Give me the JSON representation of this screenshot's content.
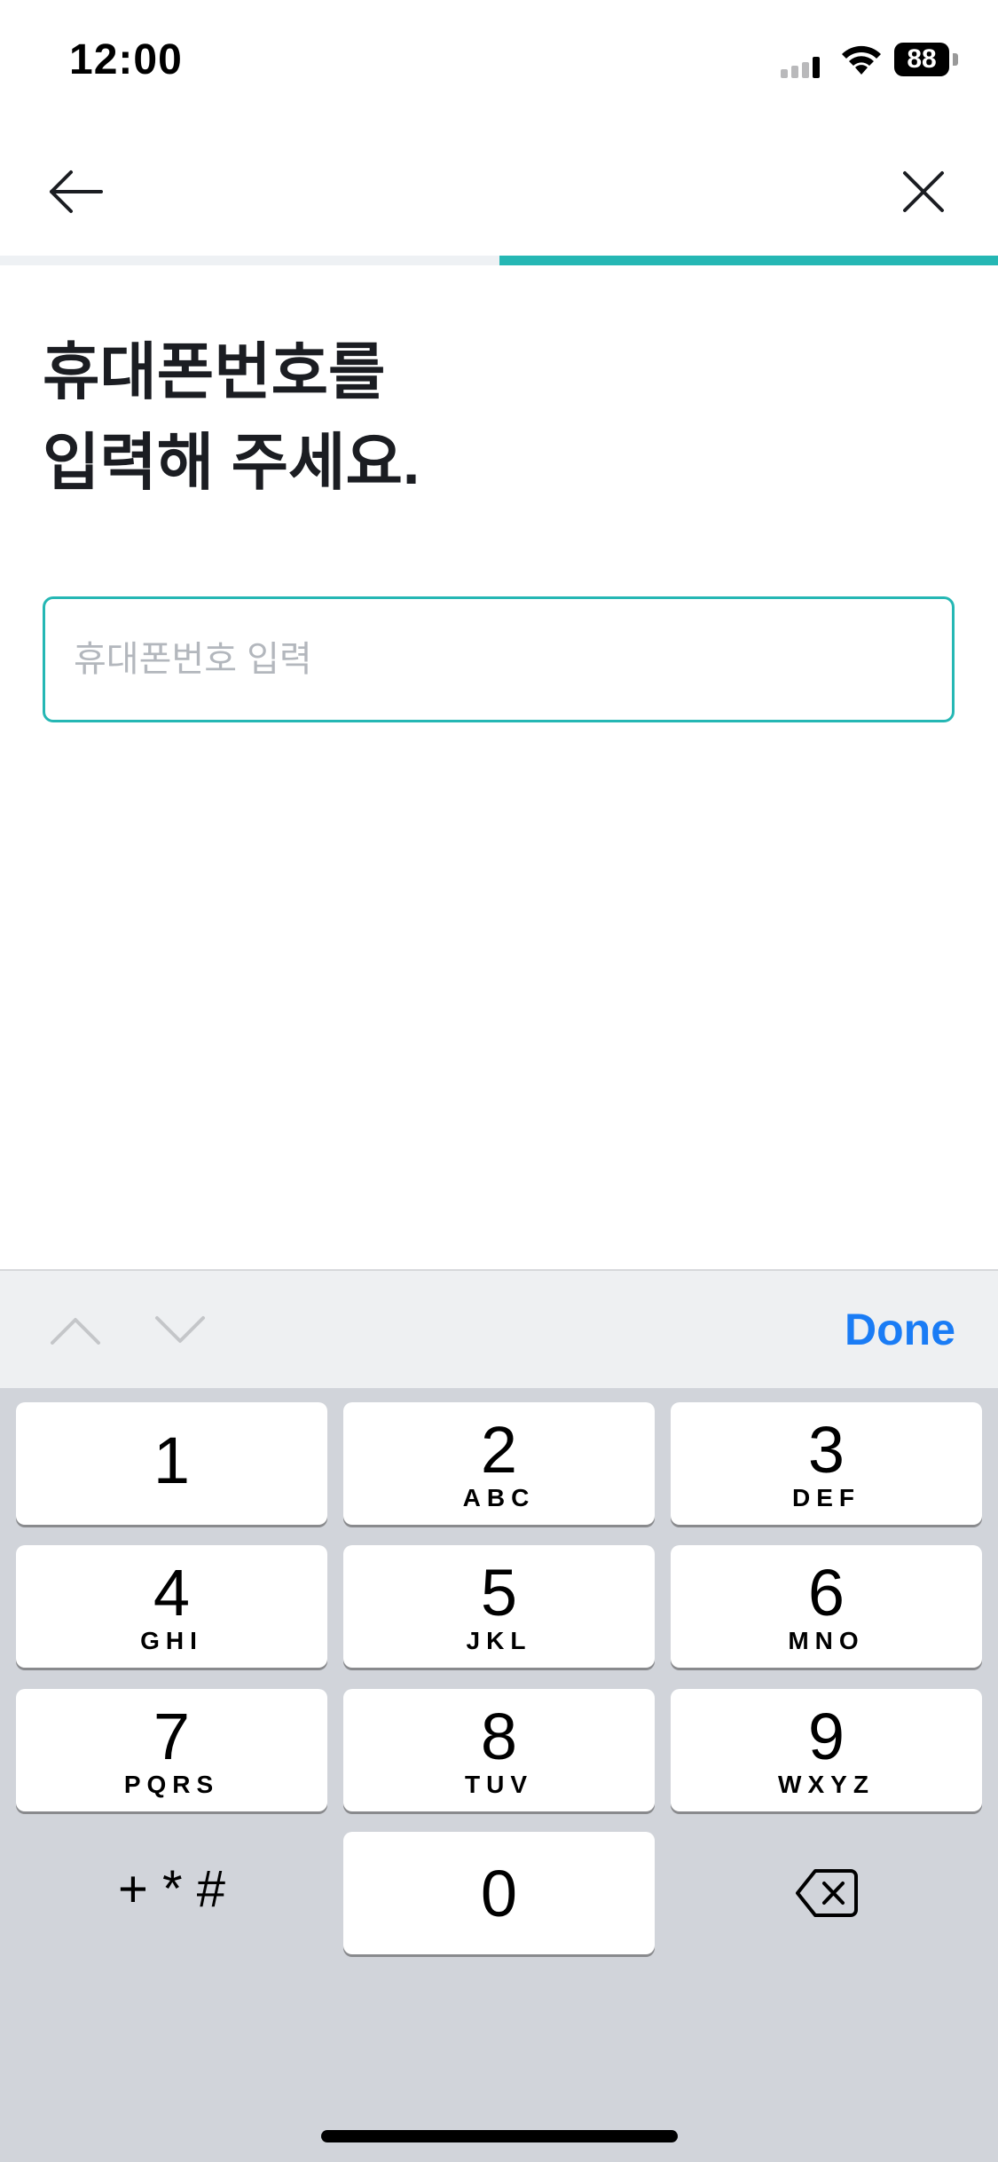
{
  "status_bar": {
    "time": "12:00",
    "battery": "88"
  },
  "nav": {
    "back_icon": "arrow-left-icon",
    "close_icon": "close-icon"
  },
  "progress": {
    "fraction": 0.5,
    "fill_color": "#25b7b4",
    "track_color": "#eef1f4"
  },
  "heading": {
    "line1": "휴대폰번호를",
    "line2": "입력해 주세요."
  },
  "phone_input": {
    "value": "",
    "placeholder": "휴대폰번호 입력"
  },
  "accessory": {
    "done_label": "Done",
    "done_color": "#1a7cf5"
  },
  "keypad": {
    "keys": [
      {
        "digit": "1",
        "letters": ""
      },
      {
        "digit": "2",
        "letters": "ABC"
      },
      {
        "digit": "3",
        "letters": "DEF"
      },
      {
        "digit": "4",
        "letters": "GHI"
      },
      {
        "digit": "5",
        "letters": "JKL"
      },
      {
        "digit": "6",
        "letters": "MNO"
      },
      {
        "digit": "7",
        "letters": "PQRS"
      },
      {
        "digit": "8",
        "letters": "TUV"
      },
      {
        "digit": "9",
        "letters": "WXYZ"
      },
      {
        "digit": "0",
        "letters": ""
      }
    ],
    "symbols_label": "+ * #"
  }
}
